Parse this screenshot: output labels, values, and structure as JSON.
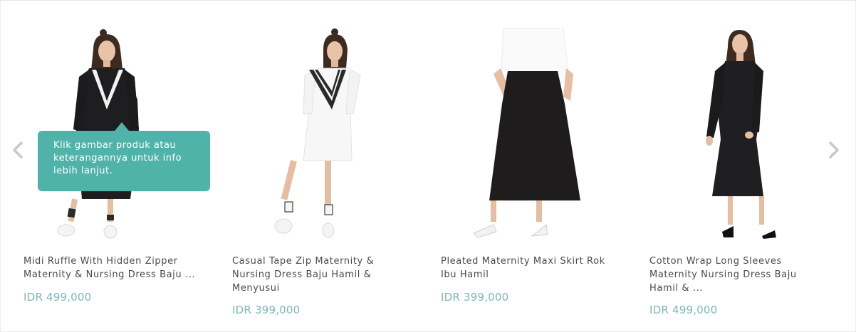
{
  "colors": {
    "price": "#79b8b4",
    "tooltip_bg": "#50b3a9",
    "arrow": "#c8c8c8",
    "text": "#4a4a4a"
  },
  "icons": {
    "prev": "chevron-left-icon",
    "next": "chevron-right-icon"
  },
  "tooltip": {
    "text": "Klik gambar produk atau keterangannya untuk info lebih lanjut."
  },
  "products": [
    {
      "name": "Midi Ruffle With Hidden Zipper Maternity & Nursing Dress Baju ...",
      "price": "IDR 499,000"
    },
    {
      "name": "Casual Tape Zip Maternity & Nursing Dress Baju Hamil & Menyusui",
      "price": "IDR 399,000"
    },
    {
      "name": "Pleated Maternity Maxi Skirt Rok Ibu Hamil",
      "price": "IDR 399,000"
    },
    {
      "name": "Cotton Wrap Long Sleeves Maternity Nursing Dress Baju Hamil & ...",
      "price": "IDR 499,000"
    }
  ]
}
